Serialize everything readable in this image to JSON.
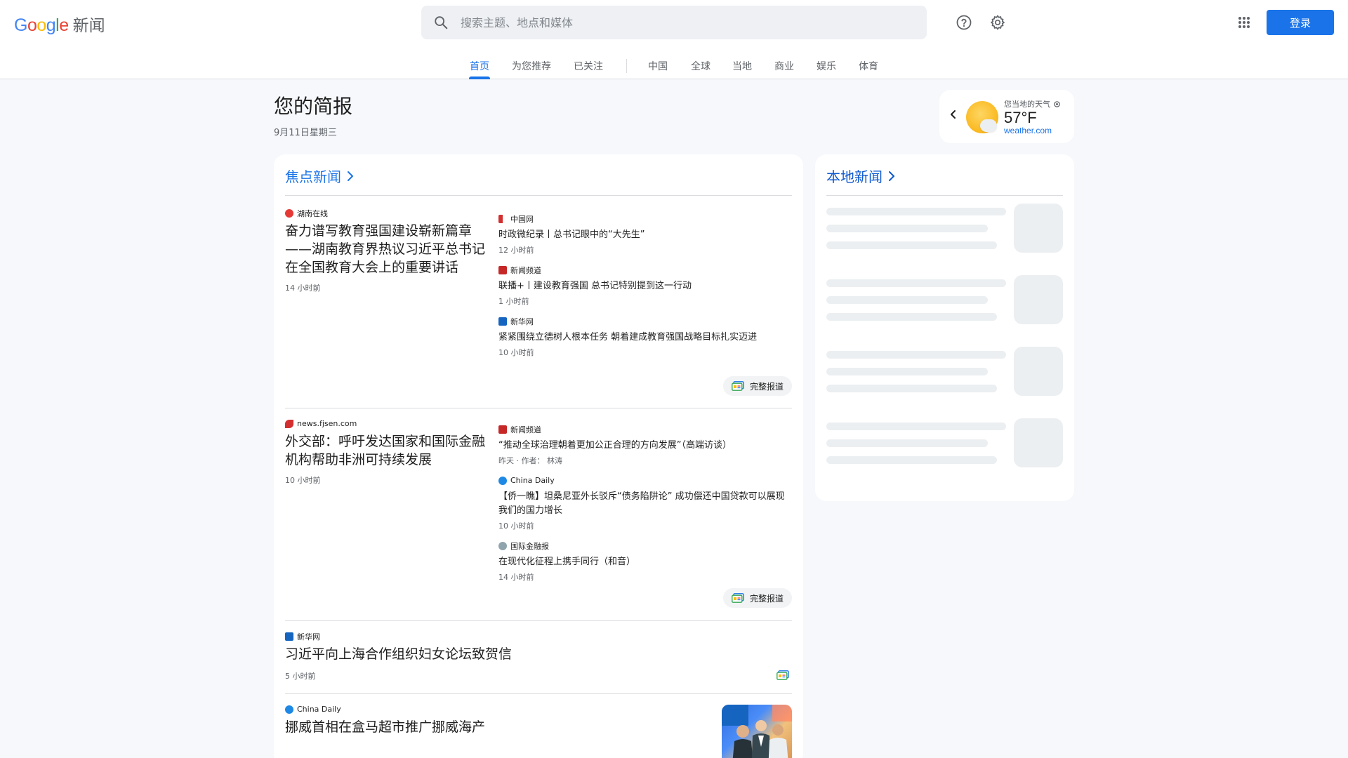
{
  "header": {
    "logo_brand": "Google",
    "logo_product": "新闻",
    "search_placeholder": "搜索主题、地点和媒体",
    "signin_label": "登录",
    "icons": [
      "search-icon",
      "help-icon",
      "settings-icon",
      "apps-icon"
    ]
  },
  "tabs": [
    "首页",
    "为您推荐",
    "已关注",
    "中国",
    "全球",
    "当地",
    "商业",
    "娱乐",
    "体育"
  ],
  "active_tab": "首页",
  "briefing": {
    "title": "您的简报",
    "date": "9月11日星期三"
  },
  "weather": {
    "label": "您当地的天气",
    "temp": "57°F",
    "source": "weather.com"
  },
  "top_stories": {
    "title": "焦点新闻",
    "full_coverage_label": "完整报道",
    "clusters": [
      {
        "lead": {
          "source": "湖南在线",
          "headline": "奋力谱写教育强国建设崭新篇章——湖南教育界热议习近平总书记在全国教育大会上的重要讲话",
          "time": "14 小时前"
        },
        "subs": [
          {
            "source": "中国网",
            "headline": "时政微纪录丨总书记眼中的“大先生”",
            "time": "12 小时前"
          },
          {
            "source": "新闻频道",
            "headline": "联播+丨建设教育强国 总书记特别提到这一行动",
            "time": "1 小时前"
          },
          {
            "source": "新华网",
            "headline": "紧紧围绕立德树人根本任务 朝着建成教育强国战略目标扎实迈进",
            "time": "10 小时前"
          }
        ]
      },
      {
        "lead": {
          "source": "news.fjsen.com",
          "headline": "外交部：呼吁发达国家和国际金融机构帮助非洲可持续发展",
          "time": "10 小时前"
        },
        "subs": [
          {
            "source": "新闻频道",
            "headline": "“推动全球治理朝着更加公正合理的方向发展”（高端访谈）",
            "time": "昨天 · 作者：  林涛"
          },
          {
            "source": "China Daily",
            "headline": "【侨一瞧】坦桑尼亚外长驳斥“债务陷阱论” 成功偿还中国贷款可以展现我们的国力增长",
            "time": "10 小时前"
          },
          {
            "source": "国际金融报",
            "headline": "在现代化征程上携手同行（和音）",
            "time": "14 小时前"
          }
        ]
      },
      {
        "lead": {
          "source": "新华网",
          "headline": "习近平向上海合作组织妇女论坛致贺信",
          "time": "5 小时前"
        }
      },
      {
        "lead": {
          "source": "China Daily",
          "headline": "挪威首相在盒马超市推广挪威海产"
        }
      }
    ]
  },
  "local_news": {
    "title": "本地新闻"
  },
  "colors": {
    "accent": "#1a73e8",
    "background": "#f6f8fc",
    "card": "#ffffff",
    "skeleton": "#eceff1"
  }
}
